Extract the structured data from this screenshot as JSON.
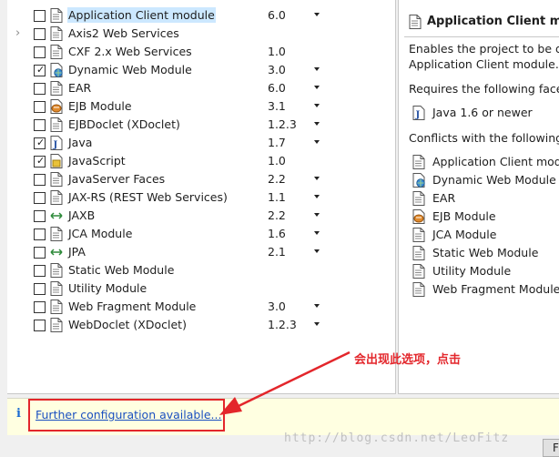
{
  "facets": [
    {
      "name": "Application Client module",
      "version": "6.0",
      "checked": false,
      "expandable": false,
      "icon": "page-icon",
      "dropdown": true,
      "selected": true
    },
    {
      "name": "Axis2 Web Services",
      "version": "",
      "checked": false,
      "expandable": true,
      "icon": "page-icon",
      "dropdown": false
    },
    {
      "name": "CXF 2.x Web Services",
      "version": "1.0",
      "checked": false,
      "expandable": false,
      "icon": "page-icon",
      "dropdown": false
    },
    {
      "name": "Dynamic Web Module",
      "version": "3.0",
      "checked": true,
      "expandable": false,
      "icon": "globe-page-icon",
      "dropdown": true
    },
    {
      "name": "EAR",
      "version": "6.0",
      "checked": false,
      "expandable": false,
      "icon": "page-icon",
      "dropdown": true
    },
    {
      "name": "EJB Module",
      "version": "3.1",
      "checked": false,
      "expandable": false,
      "icon": "bean-page-icon",
      "dropdown": true
    },
    {
      "name": "EJBDoclet (XDoclet)",
      "version": "1.2.3",
      "checked": false,
      "expandable": false,
      "icon": "page-icon",
      "dropdown": true
    },
    {
      "name": "Java",
      "version": "1.7",
      "checked": true,
      "expandable": false,
      "icon": "java-page-icon",
      "dropdown": true
    },
    {
      "name": "JavaScript",
      "version": "1.0",
      "checked": true,
      "expandable": false,
      "icon": "js-page-icon",
      "dropdown": false
    },
    {
      "name": "JavaServer Faces",
      "version": "2.2",
      "checked": false,
      "expandable": false,
      "icon": "page-icon",
      "dropdown": true
    },
    {
      "name": "JAX-RS (REST Web Services)",
      "version": "1.1",
      "checked": false,
      "expandable": false,
      "icon": "page-icon",
      "dropdown": true
    },
    {
      "name": "JAXB",
      "version": "2.2",
      "checked": false,
      "expandable": false,
      "icon": "arrows-icon",
      "dropdown": true
    },
    {
      "name": "JCA Module",
      "version": "1.6",
      "checked": false,
      "expandable": false,
      "icon": "page-icon",
      "dropdown": true
    },
    {
      "name": "JPA",
      "version": "2.1",
      "checked": false,
      "expandable": false,
      "icon": "arrows-icon",
      "dropdown": true
    },
    {
      "name": "Static Web Module",
      "version": "",
      "checked": false,
      "expandable": false,
      "icon": "page-icon",
      "dropdown": false
    },
    {
      "name": "Utility Module",
      "version": "",
      "checked": false,
      "expandable": false,
      "icon": "page-icon",
      "dropdown": false
    },
    {
      "name": "Web Fragment Module",
      "version": "3.0",
      "checked": false,
      "expandable": false,
      "icon": "page-icon",
      "dropdown": true
    },
    {
      "name": "WebDoclet (XDoclet)",
      "version": "1.2.3",
      "checked": false,
      "expandable": false,
      "icon": "page-icon",
      "dropdown": true
    }
  ],
  "details": {
    "title": "Application Client module",
    "description_line1": "Enables the project to be de",
    "description_line2": "Application Client module.",
    "requires_label": "Requires the following facet:",
    "requires": [
      {
        "name": "Java 1.6 or newer",
        "icon": "java-page-icon"
      }
    ],
    "conflicts_label": "Conflicts with the following fa",
    "conflicts": [
      {
        "name": "Application Client modu",
        "icon": "page-icon"
      },
      {
        "name": "Dynamic Web Module",
        "icon": "globe-page-icon"
      },
      {
        "name": "EAR",
        "icon": "page-icon"
      },
      {
        "name": "EJB Module",
        "icon": "bean-page-icon"
      },
      {
        "name": "JCA Module",
        "icon": "page-icon"
      },
      {
        "name": "Static Web Module",
        "icon": "page-icon"
      },
      {
        "name": "Utility Module",
        "icon": "page-icon"
      },
      {
        "name": "Web Fragment Module",
        "icon": "page-icon"
      }
    ]
  },
  "info_bar": {
    "icon": "i",
    "link_text": "Further configuration available..."
  },
  "annotation": "会出现此选项，点击",
  "watermark": "http://blog.csdn.net/LeoFitz",
  "next_button_label": "F",
  "colors": {
    "accent_red": "#e3262b",
    "link_blue": "#1a4fc0",
    "selection": "#cce8ff",
    "info_bg": "#ffffe1"
  }
}
